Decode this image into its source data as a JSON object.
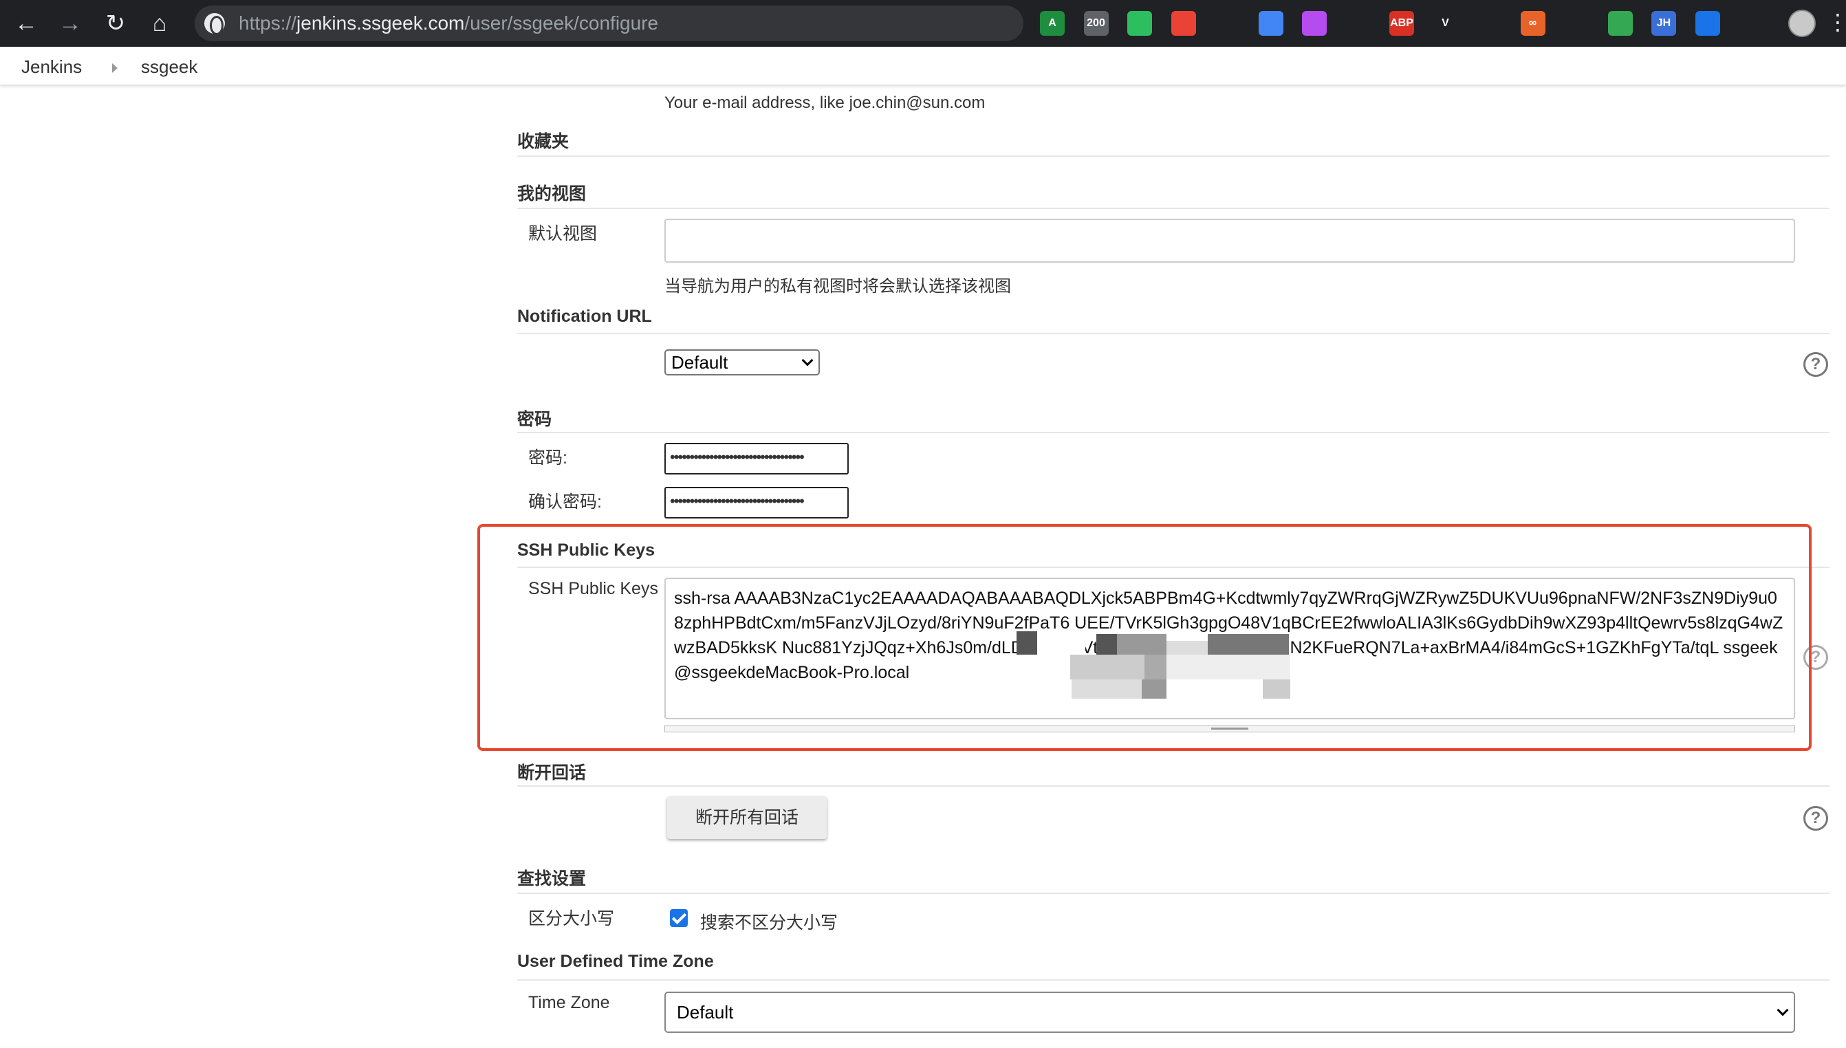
{
  "browser": {
    "url_scheme_host_prefix": "https://",
    "url_host": "jenkins.ssgeek.com",
    "url_path": "/user/ssgeek/configure"
  },
  "extensions": [
    {
      "name": "a-extension-icon",
      "text": "A",
      "color": "#1e8e3e"
    },
    {
      "name": "200-extension-icon",
      "text": "200",
      "color": "#5f6368"
    },
    {
      "name": "evernote-icon",
      "text": "",
      "color": "#2dbe60"
    },
    {
      "name": "red-extension-icon",
      "text": "",
      "color": "#ea4335"
    },
    {
      "name": "cat-extension-icon",
      "text": "",
      "color": "#202124"
    },
    {
      "name": "translate-icon",
      "text": "",
      "color": "#4285f4"
    },
    {
      "name": "star-extension-icon",
      "text": "",
      "color": "#b44cf0"
    },
    {
      "name": "glasses-extension-icon",
      "text": "",
      "color": "#202124"
    },
    {
      "name": "adblock-plus-icon",
      "text": "ABP",
      "color": "#d93025"
    },
    {
      "name": "vue-devtools-icon",
      "text": "V",
      "color": "#202124"
    },
    {
      "name": "lightbulb-extension-icon",
      "text": "",
      "color": "#202124"
    },
    {
      "name": "infinity-extension-icon",
      "text": "∞",
      "color": "#e8632a"
    },
    {
      "name": "speedometer-extension-icon",
      "text": "",
      "color": "#202124"
    },
    {
      "name": "green-diamond-extension-icon",
      "text": "",
      "color": "#34a853"
    },
    {
      "name": "jh-extension-icon",
      "text": "JH",
      "color": "#3b6fd8"
    },
    {
      "name": "cube-extension-icon",
      "text": "",
      "color": "#1a73e8"
    },
    {
      "name": "puzzle-extensions-icon",
      "text": "",
      "color": "#202124"
    }
  ],
  "breadcrumb": {
    "root": "Jenkins",
    "user": "ssgeek"
  },
  "email": {
    "help": "Your e-mail address, like joe.chin@sun.com"
  },
  "favorites": {
    "title": "收藏夹"
  },
  "my_views": {
    "title": "我的视图",
    "default_view_label": "默认视图",
    "default_view_value": "",
    "help": "当导航为用户的私有视图时将会默认选择该视图"
  },
  "notification_url": {
    "title": "Notification URL",
    "selected": "Default"
  },
  "password": {
    "title": "密码",
    "password_label": "密码:",
    "confirm_label": "确认密码:",
    "password_mask": "••••••••••••••••••••••••••••••••••",
    "confirm_mask": "••••••••••••••••••••••••••••••••••"
  },
  "ssh": {
    "title": "SSH Public Keys",
    "label": "SSH Public Keys",
    "value": "ssh-rsa AAAAB3NzaC1yc2EAAAADAQABAAABAQDLXjck5ABPBm4G+Kcdtwmly7qyZWRrqGjWZRywZ5DUKVUu96pnaNFW/2NF3sZN9Diy9u08zphHPBdtCxm/m5FanzVJjLOzyd/8riYN9uF2fPaT6                              UEE/TVrK5lGh3gpgO48V1qBCrEE2fwwloALIA3lKs6GydbDih9wXZ93p4lltQewrv5s8lzqG4wZwzBAD5kksK                                                   Nuc881YzjJQqz+Xh6Js0m/dLD53kTT4VtlYToCbMEfNeUhYtzVEmN2KFueRQN7La+axBrMA4/i84mGcS+1GZKhFgYTa/tqL ssgeek@ssgeekdeMacBook-Pro.local"
  },
  "disconnect_sessions": {
    "title": "断开回话",
    "button": "断开所有回话"
  },
  "search_settings": {
    "title": "查找设置",
    "case_label": "区分大小写",
    "case_checkbox_label": "搜索不区分大小写"
  },
  "time_zone": {
    "title": "User Defined Time Zone",
    "label": "Time Zone",
    "selected": "Default"
  }
}
